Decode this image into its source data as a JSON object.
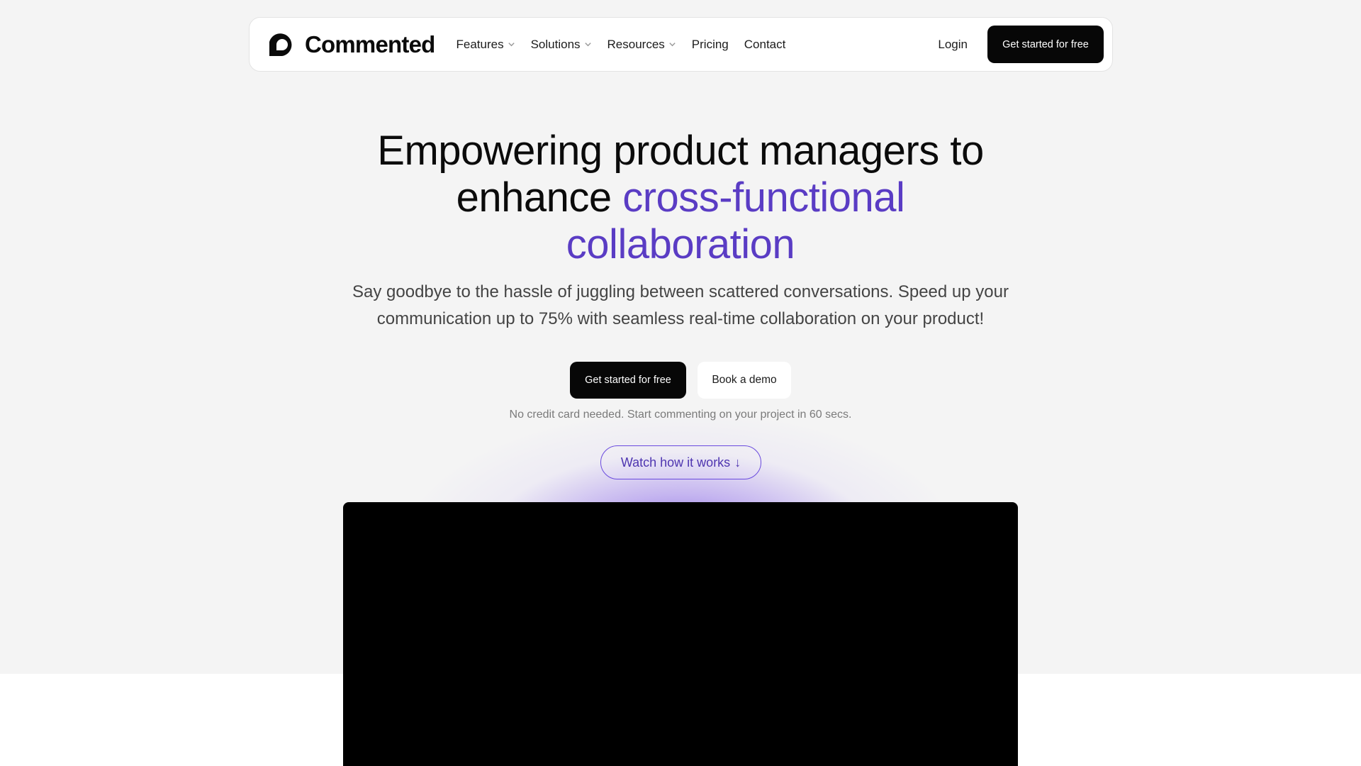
{
  "brand": {
    "name": "Commented"
  },
  "nav": {
    "items": [
      {
        "label": "Features",
        "has_dropdown": true
      },
      {
        "label": "Solutions",
        "has_dropdown": true
      },
      {
        "label": "Resources",
        "has_dropdown": true
      },
      {
        "label": "Pricing",
        "has_dropdown": false
      },
      {
        "label": "Contact",
        "has_dropdown": false
      }
    ],
    "login_label": "Login",
    "cta_label": "Get started for free"
  },
  "hero": {
    "title_line1": "Empowering product managers to",
    "title_line2_plain": "enhance ",
    "title_line2_accent": "cross-functional",
    "title_line3_accent": "collaboration",
    "subtitle": "Say goodbye to the hassle of juggling between scattered conversations. Speed up your communication up to 75% with seamless real-time collaboration on your product!",
    "primary_cta": "Get started for free",
    "secondary_cta": "Book a demo",
    "note": "No credit card needed. Start commenting on your project in 60 secs.",
    "watch_label": "Watch how it works",
    "watch_arrow": "↓"
  },
  "colors": {
    "accent": "#5a3cc4",
    "dark_button": "#070707",
    "page_bg": "#f4f4f4"
  },
  "icons": {
    "logo": "commented-d-logo-icon",
    "dropdown": "chevron-down-icon",
    "watch": "arrow-down-icon"
  }
}
